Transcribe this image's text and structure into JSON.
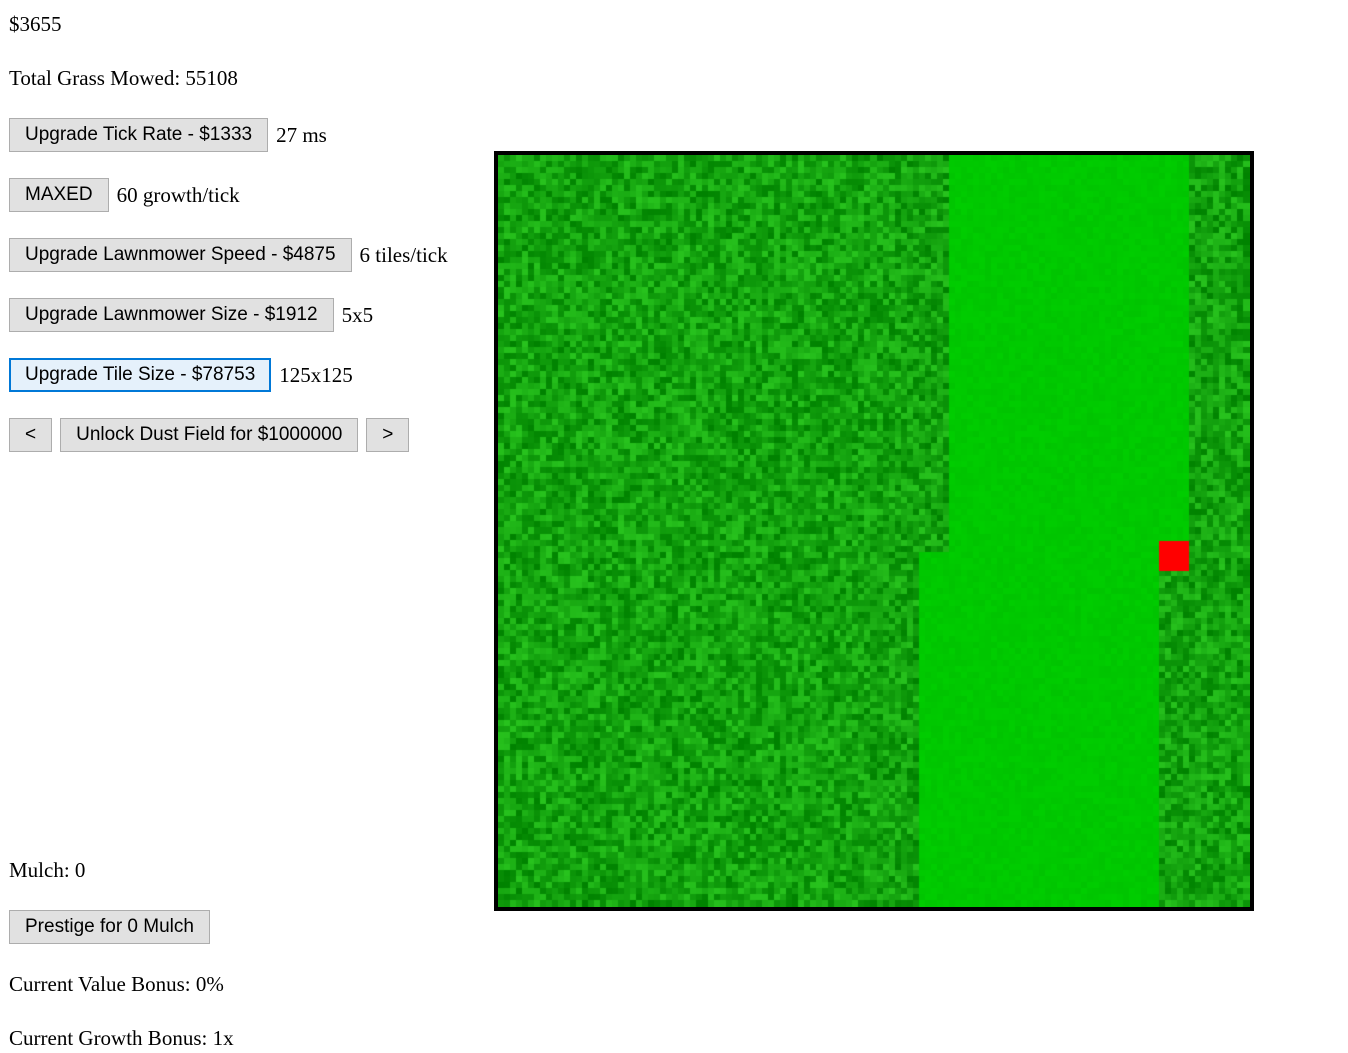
{
  "stats": {
    "money": "$3655",
    "total_grass": "Total Grass Mowed: 55108"
  },
  "upgrades": {
    "tick_rate": {
      "button": "Upgrade Tick Rate - $1333",
      "value": "27 ms"
    },
    "growth": {
      "button": "MAXED",
      "value": "60 growth/tick"
    },
    "speed": {
      "button": "Upgrade Lawnmower Speed - $4875",
      "value": "6 tiles/tick"
    },
    "size": {
      "button": "Upgrade Lawnmower Size - $1912",
      "value": "5x5"
    },
    "tile_size": {
      "button": "Upgrade Tile Size - $78753",
      "value": "125x125"
    }
  },
  "field_nav": {
    "prev": "<",
    "unlock": "Unlock Dust Field for $1000000",
    "next": ">"
  },
  "prestige": {
    "mulch": "Mulch: 0",
    "button": "Prestige for 0 Mulch",
    "value_bonus": "Current Value Bonus: 0%",
    "growth_bonus": "Current Growth Bonus: 1x"
  },
  "field": {
    "grid_size": 125,
    "colors": {
      "tall_grass_light": "#22b822",
      "tall_grass_dark": "#058a05",
      "mowed": "#00c800",
      "mower": "#ff0000"
    }
  }
}
